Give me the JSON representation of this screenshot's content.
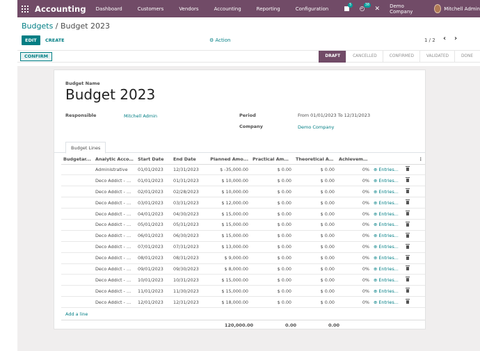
{
  "navbar": {
    "brand": "Accounting",
    "menu": [
      "Dashboard",
      "Customers",
      "Vendors",
      "Accounting",
      "Reporting",
      "Configuration"
    ],
    "chat_badge": "5",
    "activity_badge": "38",
    "company": "Demo Company",
    "user": "Mitchell Admin",
    "icons": {
      "apps": "grid-icon",
      "chat": "chat-icon",
      "activity": "clock-icon",
      "close": "close-icon"
    }
  },
  "breadcrumb": {
    "parent": "Budgets",
    "separator": " / ",
    "current": "Budget 2023"
  },
  "toolbar": {
    "edit": "EDIT",
    "create": "CREATE",
    "action": "⚙ Action"
  },
  "pager": {
    "value": "1 / 2",
    "prev": "‹",
    "next": "›"
  },
  "status": {
    "confirm": "CONFIRM",
    "stages": [
      "DRAFT",
      "CANCELLED",
      "CONFIRMED",
      "VALIDATED",
      "DONE"
    ],
    "active": "DRAFT"
  },
  "form": {
    "name_label": "Budget Name",
    "name": "Budget 2023",
    "responsible_label": "Responsible",
    "responsible": "Mitchell Admin",
    "period_label": "Period",
    "period": "From 01/01/2023 To 12/31/2023",
    "company_label": "Company",
    "company": "Demo Company"
  },
  "tab": "Budget Lines",
  "table": {
    "headers": [
      "Budgetar...",
      "Analytic Acco...",
      "Start Date",
      "End Date",
      "Planned Amo...",
      "Practical Amount",
      "Theoretical Am...",
      "Achievement",
      "",
      "",
      ""
    ],
    "kebab": "⋮",
    "rows": [
      [
        "",
        "Administrative",
        "01/01/2023",
        "12/31/2023",
        "$ -35,000.00",
        "$ 0.00",
        "$ 0.00",
        "0%",
        "⊕ Entries..."
      ],
      [
        "",
        "Deco Addict - D...",
        "01/01/2023",
        "01/31/2023",
        "$ 10,000.00",
        "$ 0.00",
        "$ 0.00",
        "0%",
        "⊕ Entries..."
      ],
      [
        "",
        "Deco Addict - D...",
        "02/01/2023",
        "02/28/2023",
        "$ 10,000.00",
        "$ 0.00",
        "$ 0.00",
        "0%",
        "⊕ Entries..."
      ],
      [
        "",
        "Deco Addict - D...",
        "03/01/2023",
        "03/31/2023",
        "$ 12,000.00",
        "$ 0.00",
        "$ 0.00",
        "0%",
        "⊕ Entries..."
      ],
      [
        "",
        "Deco Addict - D...",
        "04/01/2023",
        "04/30/2023",
        "$ 15,000.00",
        "$ 0.00",
        "$ 0.00",
        "0%",
        "⊕ Entries..."
      ],
      [
        "",
        "Deco Addict - D...",
        "05/01/2023",
        "05/31/2023",
        "$ 15,000.00",
        "$ 0.00",
        "$ 0.00",
        "0%",
        "⊕ Entries..."
      ],
      [
        "",
        "Deco Addict - D...",
        "06/01/2023",
        "06/30/2023",
        "$ 15,000.00",
        "$ 0.00",
        "$ 0.00",
        "0%",
        "⊕ Entries..."
      ],
      [
        "",
        "Deco Addict - D...",
        "07/01/2023",
        "07/31/2023",
        "$ 13,000.00",
        "$ 0.00",
        "$ 0.00",
        "0%",
        "⊕ Entries..."
      ],
      [
        "",
        "Deco Addict - D...",
        "08/01/2023",
        "08/31/2023",
        "$ 9,000.00",
        "$ 0.00",
        "$ 0.00",
        "0%",
        "⊕ Entries..."
      ],
      [
        "",
        "Deco Addict - D...",
        "09/01/2023",
        "09/30/2023",
        "$ 8,000.00",
        "$ 0.00",
        "$ 0.00",
        "0%",
        "⊕ Entries..."
      ],
      [
        "",
        "Deco Addict - D...",
        "10/01/2023",
        "10/31/2023",
        "$ 15,000.00",
        "$ 0.00",
        "$ 0.00",
        "0%",
        "⊕ Entries..."
      ],
      [
        "",
        "Deco Addict - D...",
        "11/01/2023",
        "11/30/2023",
        "$ 15,000.00",
        "$ 0.00",
        "$ 0.00",
        "0%",
        "⊕ Entries..."
      ],
      [
        "",
        "Deco Addict - D...",
        "12/01/2023",
        "12/31/2023",
        "$ 18,000.00",
        "$ 0.00",
        "$ 0.00",
        "0%",
        "⊕ Entries..."
      ]
    ],
    "add_line": "Add a line",
    "totals": {
      "planned": "120,000.00",
      "practical": "0.00",
      "theoretical": "0.00"
    }
  },
  "colors": {
    "brand": "#714b67",
    "accent": "#017e84"
  }
}
